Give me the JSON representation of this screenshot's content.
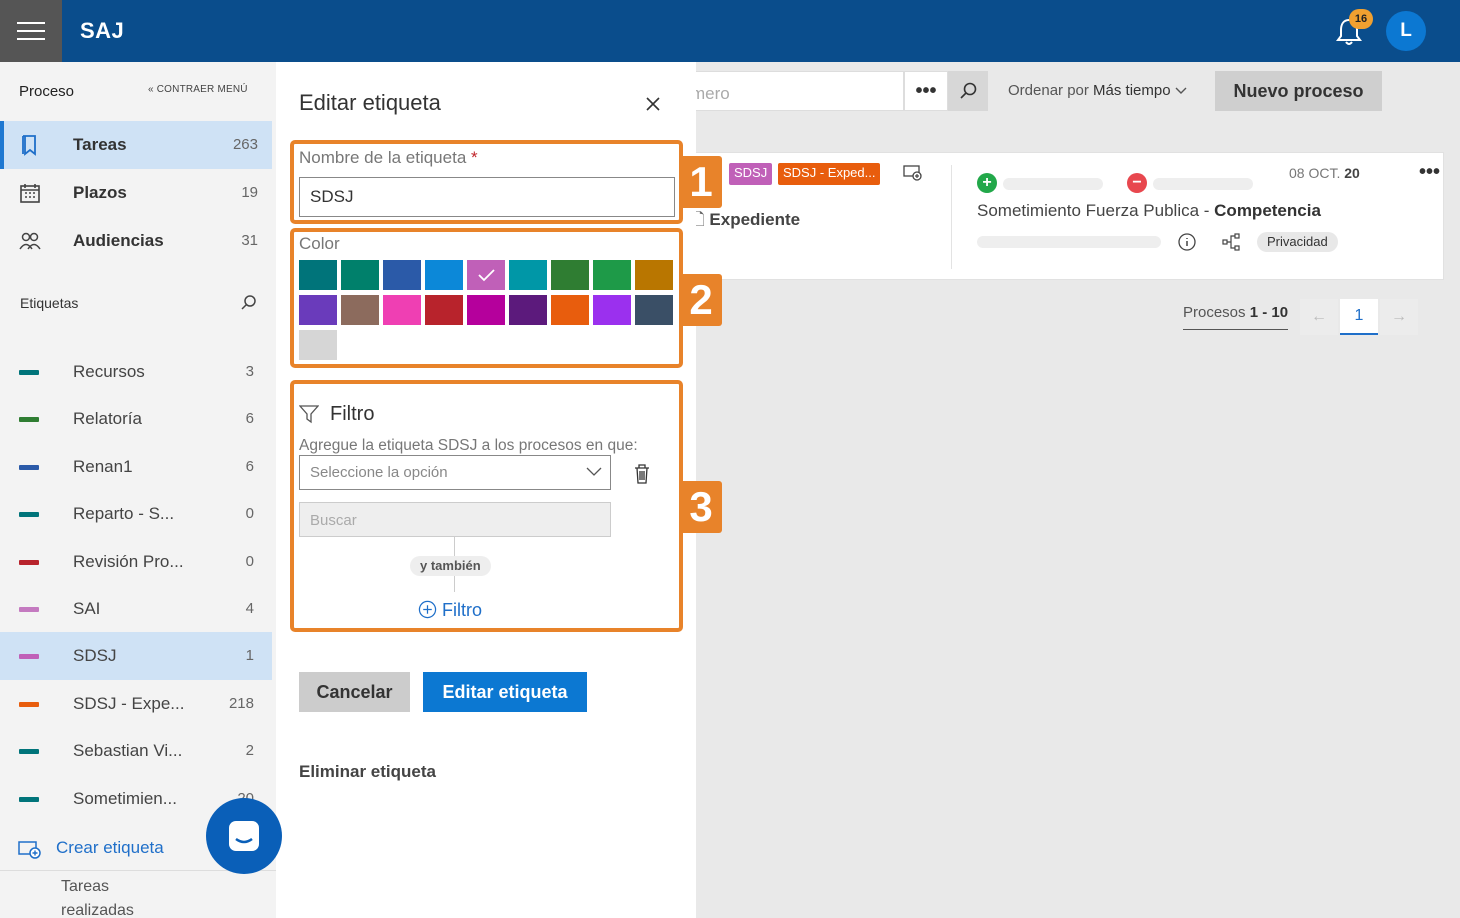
{
  "app": {
    "brand": "SAJ",
    "notifications": "16",
    "avatar": "L"
  },
  "sidebar": {
    "proceso": "Proceso",
    "contraer": "CONTRAER MENÚ",
    "nav": [
      {
        "label": "Tareas",
        "count": "263"
      },
      {
        "label": "Plazos",
        "count": "19"
      },
      {
        "label": "Audiencias",
        "count": "31"
      }
    ],
    "etiquetas_title": "Etiquetas",
    "tags": [
      {
        "label": "Recursos",
        "count": "3",
        "color": "#00747a"
      },
      {
        "label": "Relatoría",
        "count": "6",
        "color": "#2f7d32"
      },
      {
        "label": "Renan1",
        "count": "6",
        "color": "#2b5aa8"
      },
      {
        "label": "Reparto - S...",
        "count": "0",
        "color": "#00747a"
      },
      {
        "label": "Revisión Pro...",
        "count": "0",
        "color": "#b8232c"
      },
      {
        "label": "SAI",
        "count": "4",
        "color": "#c47ac0"
      },
      {
        "label": "SDSJ",
        "count": "1",
        "color": "#c060b8"
      },
      {
        "label": "SDSJ - Expe...",
        "count": "218",
        "color": "#e85d0d"
      },
      {
        "label": "Sebastian Vi...",
        "count": "2",
        "color": "#00747a"
      },
      {
        "label": "Sometimien...",
        "count": "20",
        "color": "#00747a"
      }
    ],
    "crear": "Crear etiqueta",
    "realizadas": "Tareas realizadas"
  },
  "toolbar": {
    "search_placeholder": "mero",
    "dots": "•••",
    "ordenar_label": "Ordenar por",
    "ordenar_value": "Más tiempo",
    "nuevo": "Nuevo proceso"
  },
  "card": {
    "chip1": "SDSJ",
    "chip1_color": "#c060b8",
    "chip2": "SDSJ - Exped...",
    "chip2_color": "#e85d0d",
    "expediente": "Expediente",
    "date_prefix": "08 OCT.",
    "date_day": "20",
    "title": "Sometimiento Fuerza Publica - ",
    "title_bold": "Competencia",
    "privacidad": "Privacidad"
  },
  "pagination": {
    "label": "Procesos",
    "range": "1 - 10",
    "page": "1"
  },
  "panel": {
    "title": "Editar etiqueta",
    "name_label": "Nombre de la etiqueta",
    "required": "*",
    "name_value": "SDSJ",
    "color_label": "Color",
    "colors": [
      "#00747a",
      "#00806b",
      "#2b5aa8",
      "#0c88d8",
      "#c060b8",
      "#0097a7",
      "#2f7d32",
      "#1e9a48",
      "#b97600",
      "#6a3bbb",
      "#8c6b5d",
      "#ef3fb3",
      "#b8232c",
      "#b5009c",
      "#5c1a7c",
      "#e85d0d",
      "#9b30ee",
      "#3a4f66",
      "#d6d6d6"
    ],
    "selected_color": "#c060b8",
    "filtro_title": "Filtro",
    "agregue": "Agregue la etiqueta SDSJ a los procesos en que:",
    "select_placeholder": "Seleccione la opción",
    "buscar_placeholder": "Buscar",
    "y_tambien": "y también",
    "add_filtro": "Filtro",
    "cancel": "Cancelar",
    "submit": "Editar etiqueta",
    "delete": "Eliminar etiqueta"
  },
  "callouts": [
    "1",
    "2",
    "3"
  ],
  "accent": "#e8832a"
}
